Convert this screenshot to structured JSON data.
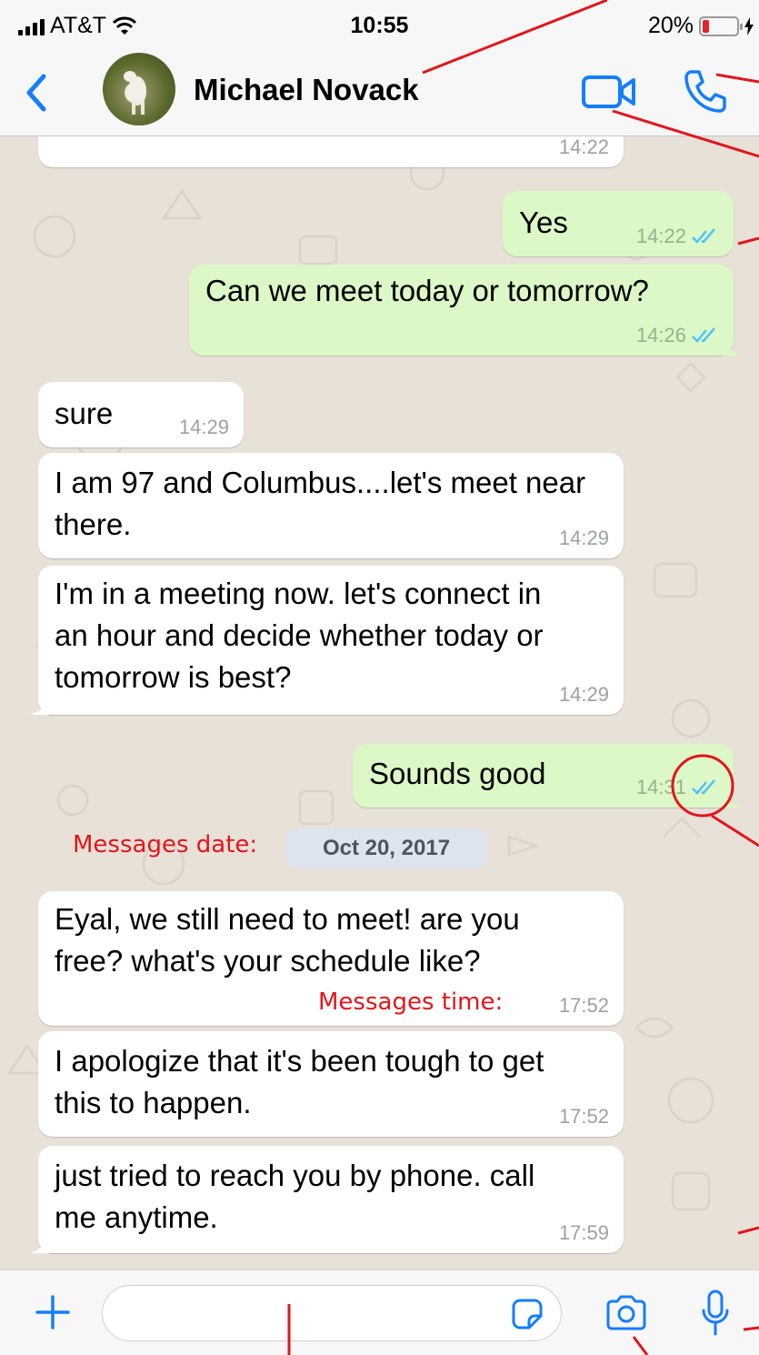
{
  "status_bar": {
    "carrier": "AT&T",
    "time": "10:55",
    "battery_percent": "20%",
    "battery_level": 0.2
  },
  "header": {
    "contact_name": "Michael Novack",
    "icons": [
      "back-chevron-icon",
      "video-call-icon",
      "phone-icon"
    ]
  },
  "messages": [
    {
      "direction": "in",
      "text": "",
      "time": "14:22"
    },
    {
      "direction": "out",
      "text": "Yes",
      "time": "14:22",
      "read": true
    },
    {
      "direction": "out",
      "text": "Can we meet today or tomorrow?",
      "time": "14:26",
      "read": true
    },
    {
      "direction": "in",
      "text": "sure",
      "time": "14:29"
    },
    {
      "direction": "in",
      "text": "I am 97 and Columbus....let's meet near there.",
      "time": "14:29"
    },
    {
      "direction": "in",
      "text": "I'm in a meeting now.  let's connect in an hour and decide whether today or tomorrow is best?",
      "time": "14:29"
    },
    {
      "direction": "out",
      "text": "Sounds good",
      "time": "14:31",
      "read": true
    },
    {
      "direction": "in",
      "text": "Eyal, we still need to meet!  are you free?  what's your schedule like?",
      "time": "17:52"
    },
    {
      "direction": "in",
      "text": "I apologize that it's been tough to get this to happen.",
      "time": "17:52"
    },
    {
      "direction": "in",
      "text": "just tried to reach you by phone. call me anytime.",
      "time": "17:59"
    }
  ],
  "date_separator": "Oct 20, 2017",
  "annotations": {
    "date_label": "Messages date:",
    "time_label": "Messages time:",
    "color": "#e3151c"
  },
  "input_bar": {
    "placeholder": "",
    "icons": [
      "plus-icon",
      "sticker-icon",
      "camera-icon",
      "microphone-icon"
    ]
  },
  "colors": {
    "accent": "#147efb",
    "outgoing_bubble": "#dcf8c6",
    "incoming_bubble": "#ffffff",
    "read_tick": "#4fc3f7",
    "chat_background": "#e8e1d8"
  }
}
